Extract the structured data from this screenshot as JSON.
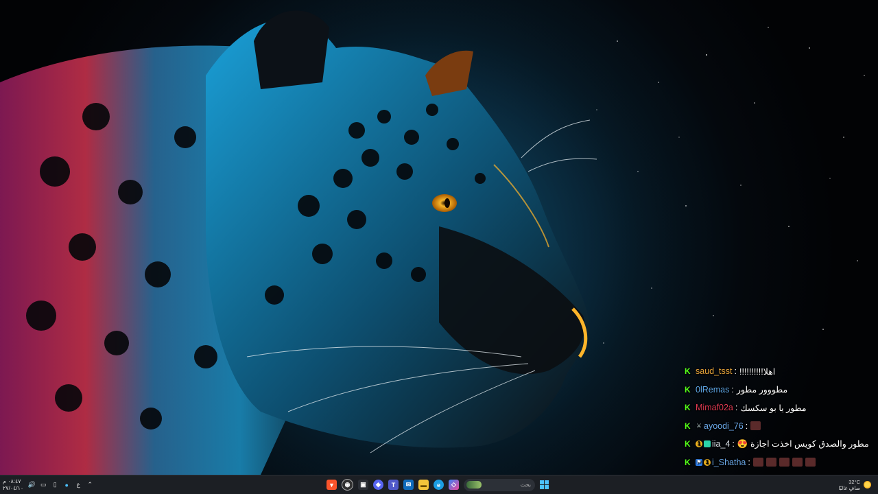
{
  "chat": {
    "messages": [
      {
        "user": "saud_tsst",
        "user_color": "#e8a53a",
        "sep": ":",
        "text": "!!!!!!!!!!اهلا",
        "badges": [],
        "emotes": 0
      },
      {
        "user": "0lRemas",
        "user_color": "#5fa8e8",
        "sep": ":",
        "text": "مطووور مطور",
        "badges": [],
        "emotes": 0
      },
      {
        "user": "Mimaf02a",
        "user_color": "#e03a52",
        "sep": ":",
        "text": "مطور يا بو سكسك",
        "badges": [],
        "emotes": 0
      },
      {
        "user": "ayoodi_76",
        "user_color": "#6aa8e8",
        "sep": ":",
        "text": "",
        "badges": [
          "sword"
        ],
        "emotes": 1
      },
      {
        "user": "iia_4",
        "user_color": "#d8e0e8",
        "sep": ":",
        "text": "😍 مطور والصدق كويس اخذت اجازة",
        "badges": [
          "sub-1",
          "sub-tier"
        ],
        "emotes": 0
      },
      {
        "user": "i_Shatha",
        "user_color": "#6aa8e8",
        "sep": ":",
        "text": "",
        "badges": [
          "mod",
          "sub-1"
        ],
        "emotes": 5
      }
    ]
  },
  "taskbar": {
    "clock_time": "٠٨:٤٧ م",
    "clock_date": "٢٧/٠٤/١٠",
    "lang": "ع",
    "search_placeholder": "بحث",
    "weather_temp": "32°C",
    "weather_desc": "صافٍ غالبًا"
  },
  "colors": {
    "kick_green": "#53fc18",
    "taskbar_bg": "#1c1f24",
    "start_blue": "#4cc2ff"
  }
}
